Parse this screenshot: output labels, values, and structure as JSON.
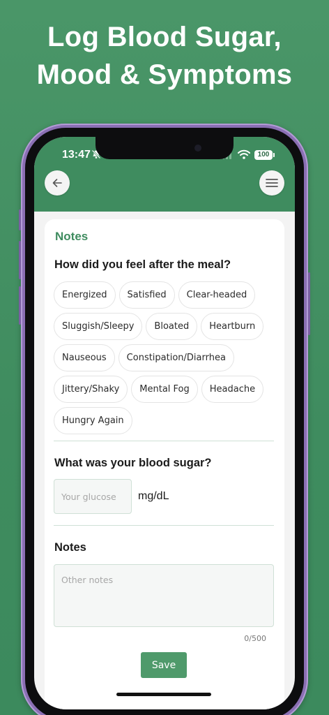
{
  "promo": {
    "headline_line1": "Log Blood Sugar,",
    "headline_line2": "Mood & Symptoms"
  },
  "status_bar": {
    "time": "13:47",
    "battery": "100",
    "icons": [
      "bell-slash-icon",
      "signal-icon",
      "wifi-icon",
      "battery-icon"
    ]
  },
  "nav": {
    "back_icon": "arrow-left-icon",
    "menu_icon": "hamburger-menu-icon"
  },
  "form": {
    "section_title": "Notes",
    "feelings_question": "How did you feel after the meal?",
    "feelings": [
      "Energized",
      "Satisfied",
      "Clear-headed",
      "Sluggish/Sleepy",
      "Bloated",
      "Heartburn",
      "Nauseous",
      "Constipation/Diarrhea",
      "Jittery/Shaky",
      "Mental Fog",
      "Headache",
      "Hungry Again"
    ],
    "glucose_question": "What was your blood sugar?",
    "glucose_placeholder": "Your glucose",
    "glucose_unit": "mg/dL",
    "notes_label": "Notes",
    "notes_placeholder": "Other notes",
    "notes_counter": "0/500",
    "save_label": "Save"
  },
  "colors": {
    "brand_green": "#3f8c5f",
    "button_green": "#4f9a6b",
    "frame_purple": "#8a6fb3"
  }
}
